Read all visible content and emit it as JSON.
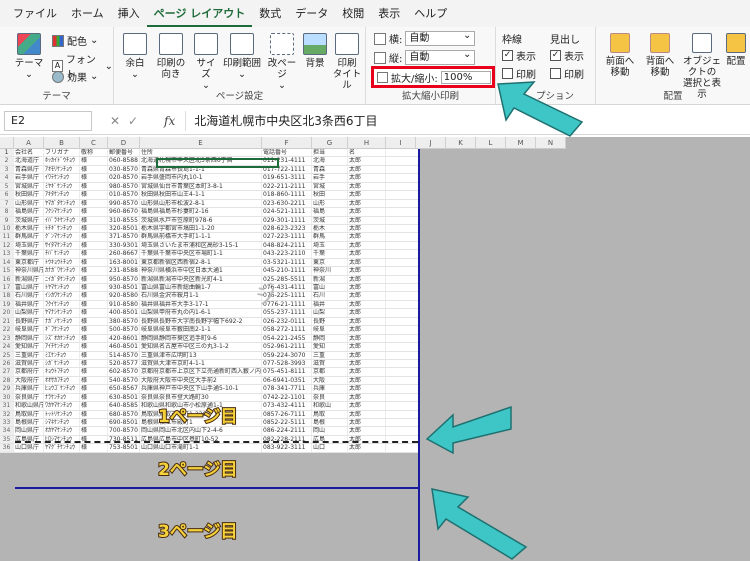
{
  "tabs": [
    "ファイル",
    "ホーム",
    "挿入",
    "ページ レイアウト",
    "数式",
    "データ",
    "校閲",
    "表示",
    "ヘルプ"
  ],
  "active_tab": "ページ レイアウト",
  "ribbon": {
    "theme_group": {
      "label": "テーマ",
      "theme_btn": "テーマ",
      "colors": "配色",
      "fonts": "フォント",
      "effects": "効果"
    },
    "page_setup": {
      "label": "ページ設定",
      "margins": "余白",
      "orientation": "印刷の\n向き",
      "size": "サイズ",
      "print_area": "印刷範囲",
      "breaks": "改ページ",
      "background": "背景",
      "print_titles": "印刷\nタイトル"
    },
    "scale": {
      "label": "拡大縮小印刷",
      "width_label": "横:",
      "width_value": "自動",
      "height_label": "縦:",
      "height_value": "自動",
      "scale_label": "拡大/縮小:",
      "scale_value": "100%"
    },
    "sheet_options": {
      "label": "シートのオプション",
      "label_visible": "プション",
      "gridlines": "枠線",
      "headings": "見出し",
      "view": "表示",
      "print": "印刷"
    },
    "arrange": {
      "label": "配置",
      "bring_forward": "前面へ\n移動",
      "send_backward": "背面へ\n移動",
      "selection_pane": "オブジェクトの\n選択と表示",
      "align": "配置"
    }
  },
  "formula_bar": {
    "name_box": "E2",
    "value": "北海道札幌市中央区北3条西6丁目"
  },
  "columns": [
    "A",
    "B",
    "C",
    "D",
    "E",
    "F",
    "G",
    "H",
    "I",
    "J",
    "K",
    "L",
    "M",
    "N"
  ],
  "header_row": [
    "会社名",
    "フリガナ",
    "敬称",
    "郵便番号",
    "住所",
    "電話番号",
    "担当",
    "名"
  ],
  "rows": [
    [
      "北海道庁",
      "ﾎｯｶｲﾄﾞｳﾁｮｳ",
      "様",
      "060-8588",
      "北海道札幌市中央区北3条西6丁目",
      "011-231-4111",
      "北海",
      "太郎"
    ],
    [
      "青森県庁",
      "ｱｵﾓﾘｹﾝﾁｮｳ",
      "様",
      "030-8570",
      "青森県青森市長島1-1-1",
      "017-722-1111",
      "青森",
      "太郎"
    ],
    [
      "岩手県庁",
      "ｲﾜﾃｹﾝﾁｮｳ",
      "様",
      "020-8570",
      "岩手県盛岡市内丸10-1",
      "019-651-3111",
      "岩手",
      "太郎"
    ],
    [
      "宮城県庁",
      "ﾐﾔｷﾞｹﾝﾁｮｳ",
      "様",
      "980-8570",
      "宮城県仙台市青葉区本町3-8-1",
      "022-211-2111",
      "宮城",
      "太郎"
    ],
    [
      "秋田県庁",
      "ｱｷﾀｹﾝﾁｮｳ",
      "様",
      "010-8570",
      "秋田県秋田市山王4-1-1",
      "018-860-1111",
      "秋田",
      "太郎"
    ],
    [
      "山形県庁",
      "ﾔﾏｶﾞﾀｹﾝﾁｮｳ",
      "様",
      "990-8570",
      "山形県山形市松波2-8-1",
      "023-630-2211",
      "山形",
      "太郎"
    ],
    [
      "福島県庁",
      "ﾌｸｼﾏｹﾝﾁｮｳ",
      "様",
      "960-8670",
      "福島県福島市杉妻町2-16",
      "024-521-1111",
      "福島",
      "太郎"
    ],
    [
      "茨城県庁",
      "ｲﾊﾞﾗｷｹﾝﾁｮｳ",
      "様",
      "310-8555",
      "茨城県水戸市笠原町978-6",
      "029-301-1111",
      "茨城",
      "太郎"
    ],
    [
      "栃木県庁",
      "ﾄﾁｷﾞｹﾝﾁｮｳ",
      "様",
      "320-8501",
      "栃木県宇都宮市塙田1-1-20",
      "028-623-2323",
      "栃木",
      "太郎"
    ],
    [
      "群馬県庁",
      "ｸﾞﾝﾏｹﾝﾁｮｳ",
      "様",
      "371-8570",
      "群馬県前橋市大手町1-1-1",
      "027-223-1111",
      "群馬",
      "太郎"
    ],
    [
      "埼玉県庁",
      "ｻｲﾀﾏｹﾝﾁｮｳ",
      "様",
      "330-9301",
      "埼玉県さいたま市浦和区高砂3-15-1",
      "048-824-2111",
      "埼玉",
      "太郎"
    ],
    [
      "千葉県庁",
      "ﾁﾊﾞｹﾝﾁｮｳ",
      "様",
      "260-8667",
      "千葉県千葉市中央区市場町1-1",
      "043-223-2110",
      "千葉",
      "太郎"
    ],
    [
      "東京都庁",
      "ﾄｳｷｮｳﾄﾁｮｳ",
      "様",
      "163-8001",
      "東京都新宿区西新宿2-8-1",
      "03-5321-1111",
      "東京",
      "太郎"
    ],
    [
      "神奈川県庁",
      "ｶﾅｶﾞﾜｹﾝﾁｮｳ",
      "様",
      "231-8588",
      "神奈川県横浜市中区日本大通1",
      "045-210-1111",
      "神奈川",
      "太郎"
    ],
    [
      "新潟県庁",
      "ﾆｲｶﾞﾀｹﾝﾁｮｳ",
      "様",
      "950-8570",
      "新潟県新潟市中央区新光町4-1",
      "025-285-5511",
      "新潟",
      "太郎"
    ],
    [
      "富山県庁",
      "ﾄﾔﾏｹﾝﾁｮｳ",
      "様",
      "930-8501",
      "富山県富山市新総曲輪1-7",
      "076-431-4111",
      "富山",
      "太郎"
    ],
    [
      "石川県庁",
      "ｲｼｶﾜｹﾝﾁｮｳ",
      "様",
      "920-8580",
      "石川県金沢市鞍月1-1",
      "076-225-1111",
      "石川",
      "太郎"
    ],
    [
      "福井県庁",
      "ﾌｸｲｹﾝﾁｮｳ",
      "様",
      "910-8580",
      "福井県福井市大手3-17-1",
      "0776-21-1111",
      "福井",
      "太郎"
    ],
    [
      "山梨県庁",
      "ﾔﾏﾅｼｹﾝﾁｮｳ",
      "様",
      "400-8501",
      "山梨県甲府市丸の内1-6-1",
      "055-237-1111",
      "山梨",
      "太郎"
    ],
    [
      "長野県庁",
      "ﾅｶﾞﾉｹﾝﾁｮｳ",
      "様",
      "380-8570",
      "長野県長野市大字南長野字幅下692-2",
      "026-232-0111",
      "長野",
      "太郎"
    ],
    [
      "岐阜県庁",
      "ｷﾞﾌｹﾝﾁｮｳ",
      "様",
      "500-8570",
      "岐阜県岐阜市薮田南2-1-1",
      "058-272-1111",
      "岐阜",
      "太郎"
    ],
    [
      "静岡県庁",
      "ｼｽﾞｵｶｹﾝﾁｮｳ",
      "様",
      "420-8601",
      "静岡県静岡市葵区追手町9-6",
      "054-221-2455",
      "静岡",
      "太郎"
    ],
    [
      "愛知県庁",
      "ｱｲﾁｹﾝﾁｮｳ",
      "様",
      "460-8501",
      "愛知県名古屋市中区三の丸3-1-2",
      "052-961-2111",
      "愛知",
      "太郎"
    ],
    [
      "三重県庁",
      "ﾐｴｹﾝﾁｮｳ",
      "様",
      "514-8570",
      "三重県津市広明町13",
      "059-224-3070",
      "三重",
      "太郎"
    ],
    [
      "滋賀県庁",
      "ｼｶﾞｹﾝﾁｮｳ",
      "様",
      "520-8577",
      "滋賀県大津市京町4-1-1",
      "077-528-3993",
      "滋賀",
      "太郎"
    ],
    [
      "京都府庁",
      "ｷｮｳﾄﾌﾁｮｳ",
      "様",
      "602-8570",
      "京都府京都市上京区下立売通新町西入薮ノ内町",
      "075-451-8111",
      "京都",
      "太郎"
    ],
    [
      "大阪府庁",
      "ｵｵｻｶﾌﾁｮｳ",
      "様",
      "540-8570",
      "大阪府大阪市中央区大手前2",
      "06-6941-0351",
      "大阪",
      "太郎"
    ],
    [
      "兵庫県庁",
      "ﾋｮｳｺﾞｹﾝﾁｮｳ",
      "様",
      "650-8567",
      "兵庫県神戸市中央区下山手通5-10-1",
      "078-341-7711",
      "兵庫",
      "太郎"
    ],
    [
      "奈良県庁",
      "ﾅﾗｹﾝﾁｮｳ",
      "様",
      "630-8501",
      "奈良県奈良市登大路町30",
      "0742-22-1101",
      "奈良",
      "太郎"
    ],
    [
      "和歌山県庁",
      "ﾜｶﾔﾏｹﾝﾁｮｳ",
      "様",
      "640-8585",
      "和歌山県和歌山市小松原通1-1",
      "073-432-4111",
      "和歌山",
      "太郎"
    ],
    [
      "鳥取県庁",
      "ﾄｯﾄﾘｹﾝﾁｮｳ",
      "様",
      "680-8570",
      "鳥取県鳥取市東町1-220",
      "0857-26-7111",
      "鳥取",
      "太郎"
    ],
    [
      "島根県庁",
      "ｼﾏﾈｹﾝﾁｮｳ",
      "様",
      "690-8501",
      "島根県松江市殿町1",
      "0852-22-5111",
      "島根",
      "太郎"
    ],
    [
      "岡山県庁",
      "ｵｶﾔﾏｹﾝﾁｮｳ",
      "様",
      "700-8570",
      "岡山県岡山市北区内山下2-4-6",
      "086-224-2111",
      "岡山",
      "太郎"
    ],
    [
      "広島県庁",
      "ﾋﾛｼﾏｹﾝﾁｮｳ",
      "様",
      "730-8511",
      "広島県広島市中区基町10-52",
      "082-228-2111",
      "広島",
      "太郎"
    ],
    [
      "山口県庁",
      "ﾔﾏｸﾞﾁｹﾝﾁｮｳ",
      "様",
      "753-8501",
      "山口県山口市滝町1-1",
      "083-922-3111",
      "山口",
      "太郎"
    ]
  ],
  "watermark": "ジ",
  "callouts": {
    "page1": "1ページ目",
    "page2": "2ページ目",
    "page3": "3ページ目"
  },
  "colors": {
    "accent": "#1e6b3a",
    "highlight_box": "#e8001c",
    "arrow": "#3ec6c6",
    "page_break": "#1a1aa0",
    "callout_fill": "#f5d23a"
  }
}
